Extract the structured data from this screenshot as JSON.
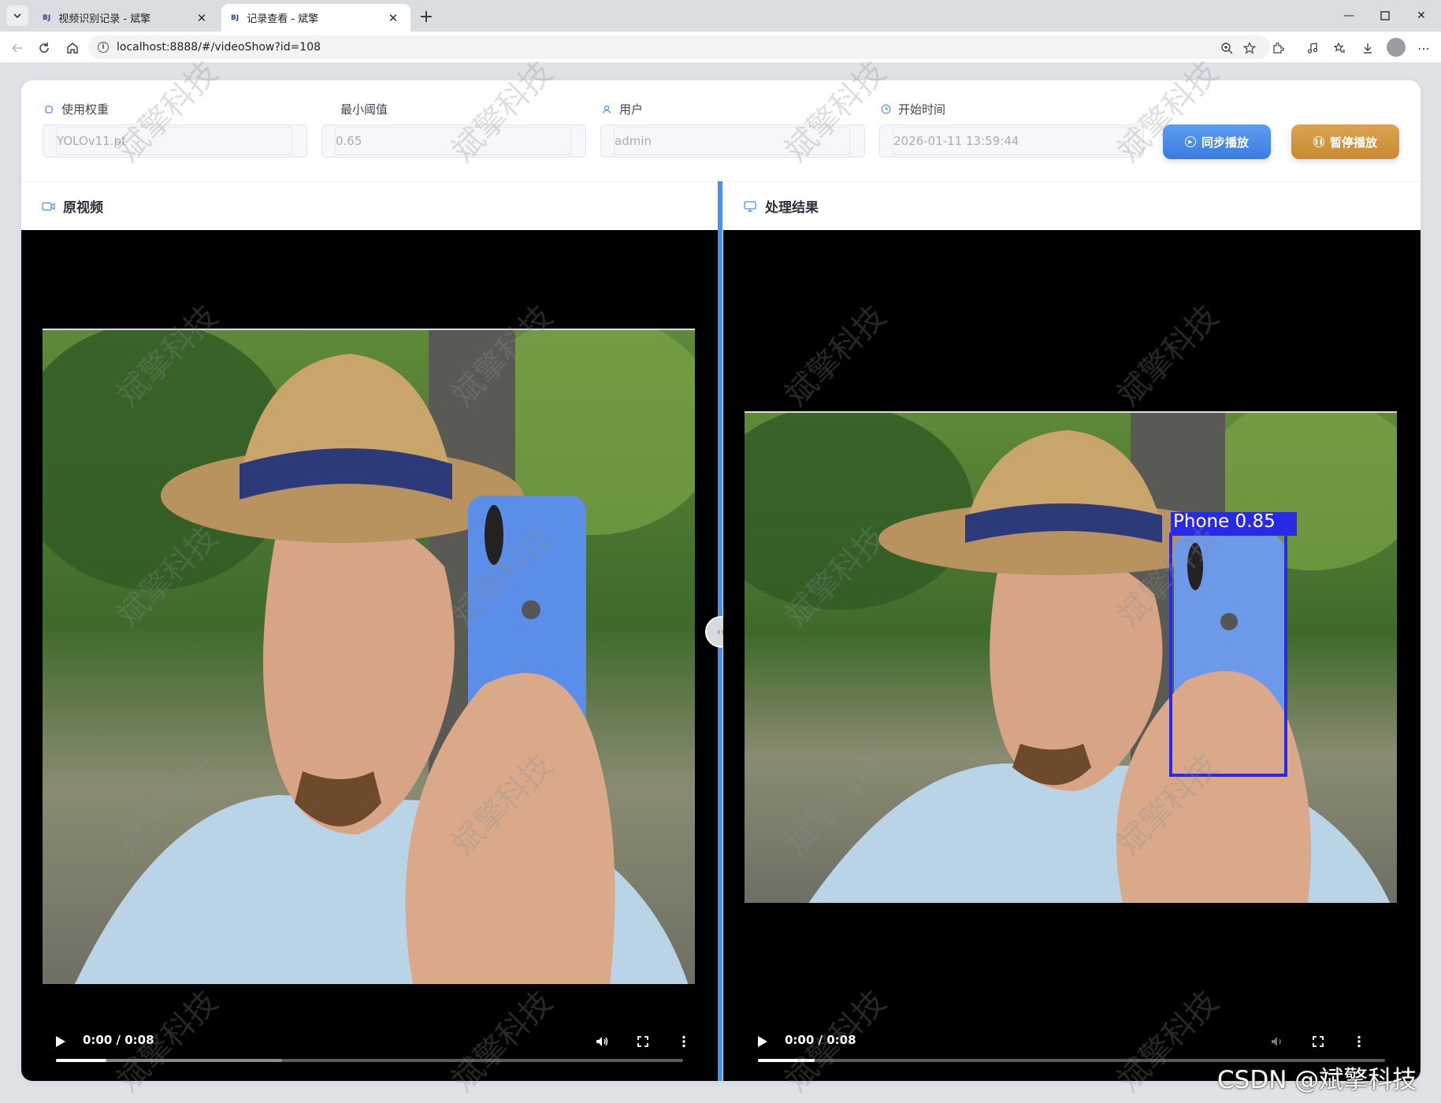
{
  "browser": {
    "tabs": [
      {
        "favicon": "BJ",
        "title": "视频识别记录 - 斌擎",
        "active": false
      },
      {
        "favicon": "BJ",
        "title": "记录查看 - 斌擎",
        "active": true
      }
    ],
    "url": "localhost:8888/#/videoShow?id=108"
  },
  "filters": {
    "weight": {
      "label": "使用权重",
      "value": "YOLOv11.pt",
      "icon": "chip-icon"
    },
    "threshold": {
      "label": "最小阈值",
      "value": "0.65"
    },
    "user": {
      "label": "用户",
      "value": "admin",
      "icon": "user-icon"
    },
    "start_time": {
      "label": "开始时间",
      "value": "2026-01-11 13:59:44",
      "icon": "clock-icon"
    }
  },
  "buttons": {
    "sync_play": "同步播放",
    "pause_play": "暂停播放"
  },
  "panels": {
    "original": {
      "title": "原视频",
      "icon": "video-camera-icon"
    },
    "result": {
      "title": "处理结果",
      "icon": "monitor-icon"
    }
  },
  "player_left": {
    "time": "0:00 / 0:08",
    "played_fraction": 0.08,
    "buffered_fraction": 0.36
  },
  "player_right": {
    "time": "0:00 / 0:08",
    "played_fraction": 0.09,
    "buffered_fraction": 0.09
  },
  "detection": {
    "label": "Phone 0.85",
    "color": "#2a2ae6"
  },
  "colors": {
    "accent": "#4d8ef2",
    "sync_button": "#3b7be0",
    "pause_button": "#c98a30"
  },
  "watermark_text": "斌擎科技",
  "credit": "CSDN @斌擎科技"
}
